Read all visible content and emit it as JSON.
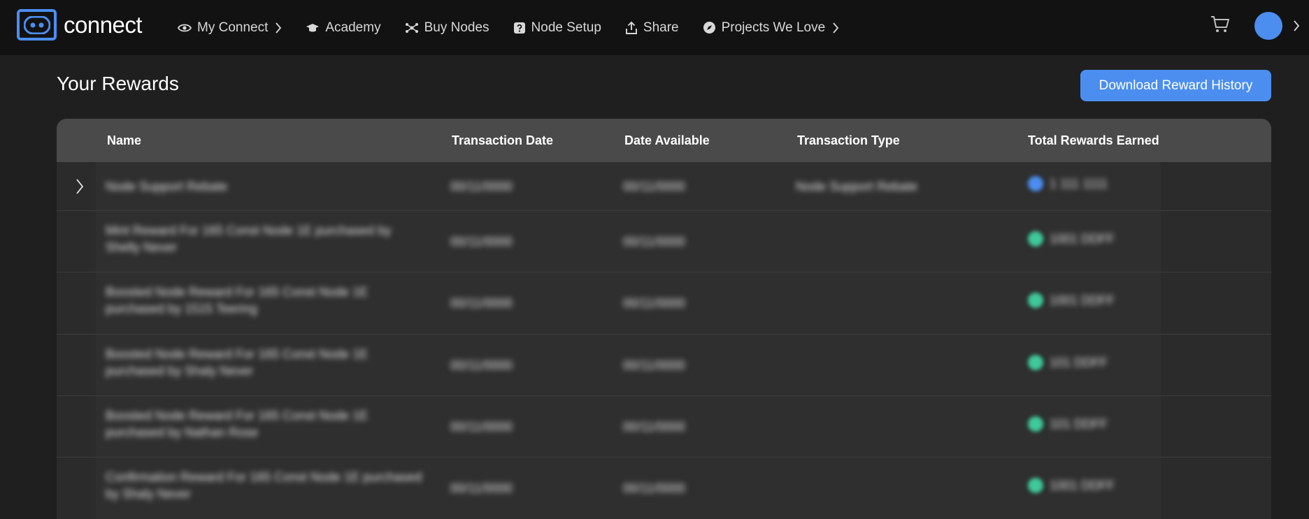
{
  "nav": {
    "logo_text": "connect",
    "items": [
      {
        "label": "My Connect",
        "icon": "eye-icon",
        "has_chevron": true
      },
      {
        "label": "Academy",
        "icon": "graduation-cap-icon",
        "has_chevron": false
      },
      {
        "label": "Buy Nodes",
        "icon": "nodes-icon",
        "has_chevron": false
      },
      {
        "label": "Node Setup",
        "icon": "help-square-icon",
        "has_chevron": false
      },
      {
        "label": "Share",
        "icon": "share-icon",
        "has_chevron": false
      },
      {
        "label": "Projects We Love",
        "icon": "compass-icon",
        "has_chevron": true
      }
    ],
    "cart_icon": "cart-icon",
    "avatar_color": "#4b8ef0"
  },
  "page": {
    "title": "Your Rewards",
    "download_button": "Download Reward History"
  },
  "table": {
    "columns": [
      "Name",
      "Transaction Date",
      "Date Available",
      "Transaction Type",
      "Total Rewards Earned"
    ],
    "rows": [
      {
        "name": "Node Support Rebate",
        "tx_date": "00/11/0000",
        "avail_date": "00/11/0000",
        "type": "Node Support Rebate",
        "amount": "1 111 1111",
        "token": "blue"
      },
      {
        "name": "Mint Reward For 165 Const Node 1E purchased by Shelly Never",
        "tx_date": "00/11/0000",
        "avail_date": "00/11/0000",
        "type": "",
        "amount": "1001 DDFF",
        "token": "green"
      },
      {
        "name": "Boosted Node Reward For 165 Const Node 1E purchased by 1515 Teering",
        "tx_date": "00/11/0000",
        "avail_date": "00/11/0000",
        "type": "",
        "amount": "1001 DDFF",
        "token": "green"
      },
      {
        "name": "Boosted Node Reward For 165 Const Node 1E purchased by Shaly Never",
        "tx_date": "00/11/0000",
        "avail_date": "00/11/0000",
        "type": "",
        "amount": "101 DDFF",
        "token": "green"
      },
      {
        "name": "Boosted Node Reward For 165 Const Node 1E purchased by Nathan Rose",
        "tx_date": "00/11/0000",
        "avail_date": "00/11/0000",
        "type": "",
        "amount": "101 DDFF",
        "token": "green"
      },
      {
        "name": "Confirmation Reward For 165 Const Node 1E purchased by Shaly Never",
        "tx_date": "00/11/0000",
        "avail_date": "00/11/0000",
        "type": "",
        "amount": "1001 DDFF",
        "token": "green"
      }
    ]
  },
  "colors": {
    "accent": "#4b8ef0",
    "token_green": "#3fc99a",
    "background": "#1f1f1f",
    "nav_bg": "#121212"
  }
}
